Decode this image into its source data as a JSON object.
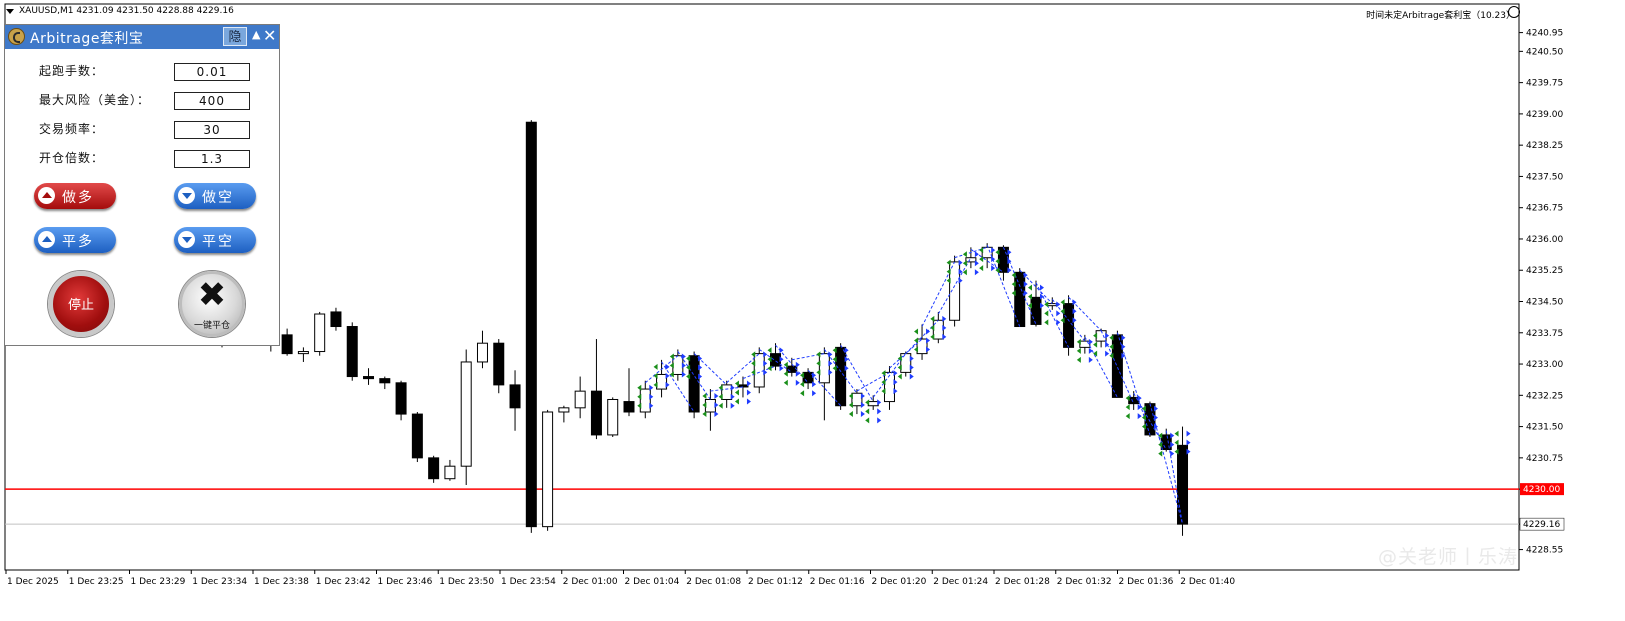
{
  "header": {
    "symbol_info": "XAUUSD,M1  4231.09 4231.50 4228.88 4229.16",
    "ea_label": "时间未定Arbitrage套利宝（10.23）"
  },
  "panel": {
    "title": "Arbitrage套利宝",
    "hide_label": "隐",
    "fields": [
      {
        "label": "起跑手数：",
        "value": "0.01"
      },
      {
        "label": "最大风险（美金）：",
        "value": "400"
      },
      {
        "label": "交易频率：",
        "value": "30"
      },
      {
        "label": "开仓倍数：",
        "value": "1.3"
      }
    ],
    "buttons": {
      "buy": "做多",
      "sell": "做空",
      "close_buy": "平多",
      "close_sell": "平空",
      "stop": "停止",
      "close_all": "一键平仓"
    },
    "colors": {
      "title_bg": "#3f79c9",
      "buy": "#c21a1a",
      "sell": "#2a6ed4"
    }
  },
  "watermark": "@关老师丨乐涛",
  "chart_data": {
    "type": "candlestick",
    "symbol": "XAUUSD",
    "timeframe": "M1",
    "ohlc_header": {
      "open": 4231.09,
      "high": 4231.5,
      "low": 4228.88,
      "close": 4229.16
    },
    "y_axis": {
      "ticks": [
        "4240.95",
        "4240.50",
        "4239.75",
        "4239.00",
        "4238.25",
        "4237.50",
        "4236.75",
        "4236.00",
        "4235.25",
        "4234.50",
        "4233.75",
        "4233.00",
        "4232.25",
        "4231.50",
        "4230.75",
        "4230.00",
        "4229.16",
        "4228.55"
      ],
      "ylim": [
        4228.3,
        4241.3
      ],
      "current_price_label": "4229.16",
      "red_line_label": "4230.00"
    },
    "x_axis": {
      "tick_labels": [
        "1 Dec 2025",
        "1 Dec 23:25",
        "1 Dec 23:29",
        "1 Dec 23:34",
        "1 Dec 23:38",
        "1 Dec 23:42",
        "1 Dec 23:46",
        "1 Dec 23:50",
        "1 Dec 23:54",
        "2 Dec 01:00",
        "2 Dec 01:04",
        "2 Dec 01:08",
        "2 Dec 01:12",
        "2 Dec 01:16",
        "2 Dec 01:20",
        "2 Dec 01:24",
        "2 Dec 01:28",
        "2 Dec 01:32",
        "2 Dec 01:36",
        "2 Dec 01:40"
      ]
    },
    "horizontal_lines": [
      {
        "price": 4230.0,
        "color": "#ff0000"
      },
      {
        "price": 4229.16,
        "color": "#c0c0c0"
      }
    ],
    "candles": [
      [
        4234.0,
        4234.6,
        4233.4,
        4234.25
      ],
      [
        4234.5,
        4234.7,
        4234.1,
        4234.45
      ],
      [
        4234.45,
        4234.7,
        4233.6,
        4233.8
      ],
      [
        4233.8,
        4234.05,
        4233.3,
        4233.7
      ],
      [
        4233.7,
        4233.85,
        4233.2,
        4233.25
      ],
      [
        4233.25,
        4233.4,
        4233.05,
        4233.3
      ],
      [
        4233.3,
        4234.25,
        4233.2,
        4234.2
      ],
      [
        4234.25,
        4234.35,
        4233.8,
        4233.9
      ],
      [
        4233.9,
        4234.0,
        4232.6,
        4232.7
      ],
      [
        4232.7,
        4232.9,
        4232.5,
        4232.65
      ],
      [
        4232.65,
        4232.7,
        4232.4,
        4232.55
      ],
      [
        4232.55,
        4232.6,
        4231.65,
        4231.8
      ],
      [
        4231.8,
        4231.85,
        4230.65,
        4230.75
      ],
      [
        4230.75,
        4230.8,
        4230.15,
        4230.25
      ],
      [
        4230.25,
        4230.7,
        4230.2,
        4230.55
      ],
      [
        4230.55,
        4233.35,
        4230.1,
        4233.05
      ],
      [
        4233.05,
        4233.8,
        4232.9,
        4233.5
      ],
      [
        4233.5,
        4233.6,
        4232.3,
        4232.5
      ],
      [
        4232.5,
        4232.85,
        4231.4,
        4231.95
      ],
      [
        4238.8,
        4238.85,
        4228.95,
        4229.1
      ],
      [
        4229.1,
        4231.9,
        4229.0,
        4231.85
      ],
      [
        4231.85,
        4232.0,
        4231.6,
        4231.95
      ],
      [
        4231.95,
        4232.7,
        4231.7,
        4232.35
      ],
      [
        4232.35,
        4233.6,
        4231.2,
        4231.3
      ],
      [
        4231.3,
        4232.2,
        4231.25,
        4232.15
      ],
      [
        4232.1,
        4232.9,
        4231.75,
        4231.85
      ],
      [
        4231.85,
        4232.6,
        4231.7,
        4232.4
      ],
      [
        4232.4,
        4233.1,
        4232.2,
        4232.75
      ],
      [
        4232.75,
        4233.35,
        4232.6,
        4233.2
      ],
      [
        4233.2,
        4233.3,
        4231.7,
        4231.85
      ],
      [
        4231.85,
        4232.4,
        4231.4,
        4232.15
      ],
      [
        4232.15,
        4232.6,
        4231.95,
        4232.5
      ],
      [
        4232.5,
        4232.7,
        4232.2,
        4232.45
      ],
      [
        4232.45,
        4233.4,
        4232.3,
        4233.25
      ],
      [
        4233.25,
        4233.5,
        4232.85,
        4232.95
      ],
      [
        4232.95,
        4233.15,
        4232.7,
        4232.8
      ],
      [
        4232.8,
        4232.9,
        4232.4,
        4232.55
      ],
      [
        4232.55,
        4233.4,
        4231.65,
        4233.25
      ],
      [
        4233.4,
        4233.5,
        4231.9,
        4232.0
      ],
      [
        4232.0,
        4232.4,
        4231.8,
        4232.3
      ],
      [
        4232.0,
        4232.25,
        4231.9,
        4232.1
      ],
      [
        4232.1,
        4232.95,
        4231.9,
        4232.8
      ],
      [
        4232.8,
        4233.3,
        4232.7,
        4233.25
      ],
      [
        4233.25,
        4233.95,
        4233.1,
        4233.6
      ],
      [
        4233.6,
        4234.25,
        4233.5,
        4234.05
      ],
      [
        4234.05,
        4235.6,
        4233.9,
        4235.45
      ],
      [
        4235.45,
        4235.8,
        4235.3,
        4235.55
      ],
      [
        4235.55,
        4235.9,
        4235.3,
        4235.8
      ],
      [
        4235.8,
        4235.85,
        4235.0,
        4235.2
      ],
      [
        4235.2,
        4235.3,
        4234.2,
        4233.9
      ],
      [
        4234.6,
        4235.0,
        4233.9,
        4233.95
      ],
      [
        4234.4,
        4234.6,
        4234.3,
        4234.45
      ],
      [
        4234.45,
        4234.65,
        4233.2,
        4233.4
      ],
      [
        4233.4,
        4233.7,
        4233.25,
        4233.55
      ],
      [
        4233.55,
        4233.85,
        4233.4,
        4233.8
      ],
      [
        4233.7,
        4233.8,
        4232.3,
        4232.2
      ],
      [
        4232.2,
        4232.35,
        4231.9,
        4232.05
      ],
      [
        4232.05,
        4232.1,
        4231.25,
        4231.3
      ],
      [
        4231.3,
        4231.45,
        4230.9,
        4230.95
      ],
      [
        4231.05,
        4231.5,
        4228.88,
        4229.16
      ]
    ],
    "trade_markers": "blue dashed arbitrage order lines with green buy arrows and blue sell arrows between 2 Dec 01:02 and 2 Dec 01:40"
  }
}
